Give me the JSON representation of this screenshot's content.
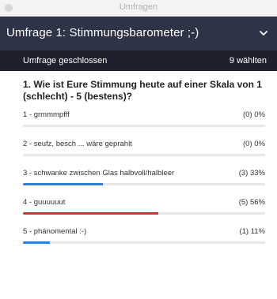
{
  "window": {
    "title": "Umfragen"
  },
  "header": {
    "title": "Umfrage 1: Stimmungsbarometer ;-)",
    "chevron_icon": "chevron-down-icon"
  },
  "status": {
    "state": "Umfrage geschlossen",
    "votes": "9 wählten"
  },
  "question": {
    "text": "1. Wie ist Eure Stimmung heute auf einer Skala von 1 (schlecht)  - 5 (bestens)?"
  },
  "options": [
    {
      "label": "1 - grmmmpfff",
      "result": "(0) 0%",
      "percent": 0,
      "highlight": false
    },
    {
      "label": "2 - seufz, besch ... wäre geprahlt",
      "result": "(0) 0%",
      "percent": 0,
      "highlight": false
    },
    {
      "label": "3 - schwanke zwischen Glas halbvoll/halbleer",
      "result": "(3) 33%",
      "percent": 33,
      "highlight": false
    },
    {
      "label": "4 - guuuuuut",
      "result": "(5) 56%",
      "percent": 56,
      "highlight": true
    },
    {
      "label": "5 - phänomental :-)",
      "result": "(1) 11%",
      "percent": 11,
      "highlight": false
    }
  ],
  "colors": {
    "header_bg": "#2e3445",
    "status_bg": "#1d212e",
    "bar_default": "#2f7fd9",
    "bar_top": "#d4302e",
    "track": "#e6e7ea"
  }
}
